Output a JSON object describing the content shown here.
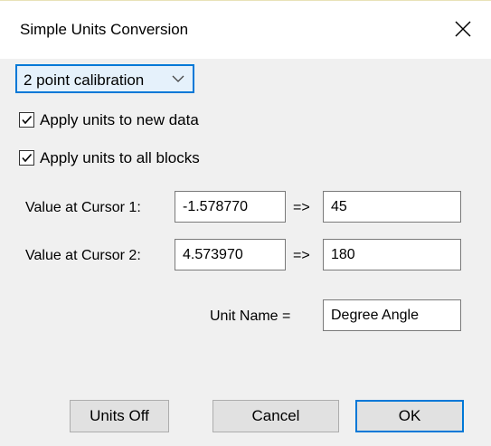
{
  "window": {
    "title": "Simple Units Conversion",
    "close_icon": "close-icon"
  },
  "mode_select": {
    "selected": "2 point calibration",
    "icon": "chevron-down-icon"
  },
  "options": {
    "apply_new_data": {
      "label": "Apply units to new data",
      "checked": true
    },
    "apply_all_blocks": {
      "label": "Apply units to all blocks",
      "checked": true
    }
  },
  "calibration": {
    "cursor1": {
      "label": "Value at Cursor 1:",
      "value": "-1.578770",
      "arrow": "=>",
      "target": "45"
    },
    "cursor2": {
      "label": "Value at Cursor 2:",
      "value": "4.573970",
      "arrow": "=>",
      "target": "180"
    }
  },
  "unit_name": {
    "label": "Unit Name =",
    "value": "Degree Angle"
  },
  "buttons": {
    "units_off": "Units Off",
    "cancel": "Cancel",
    "ok": "OK"
  },
  "colors": {
    "accent": "#0078d7",
    "dialog_bg": "#f0f0f0",
    "button_bg": "#e1e1e1"
  }
}
